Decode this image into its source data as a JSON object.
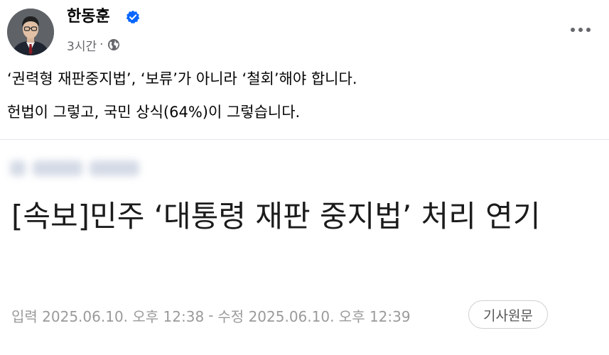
{
  "post": {
    "author_name": "한동훈",
    "time_ago": "3시간",
    "meta_separator": "·",
    "verified_icon": "verified-badge-icon",
    "audience_icon": "globe-icon",
    "more_icon": "more-horizontal-icon",
    "text_lines": [
      "‘권력형 재판중지법’, ‘보류’가 아니라 ‘철회’해야 합니다.",
      "헌법이 그렇고, 국민 상식(64%)이 그렇습니다."
    ]
  },
  "article": {
    "headline": "[속보]민주 ‘대통령 재판 중지법’ 처리 연기",
    "published": "입력 2025.06.10. 오후 12:38",
    "separator": "-",
    "modified": "수정 2025.06.10. 오후 12:39",
    "source_button_label": "기사원문"
  },
  "colors": {
    "verified_blue": "#0866ff",
    "meta_gray": "#65676b",
    "headline_text": "#1b1b1b",
    "article_meta_gray": "#9a9a9a"
  }
}
